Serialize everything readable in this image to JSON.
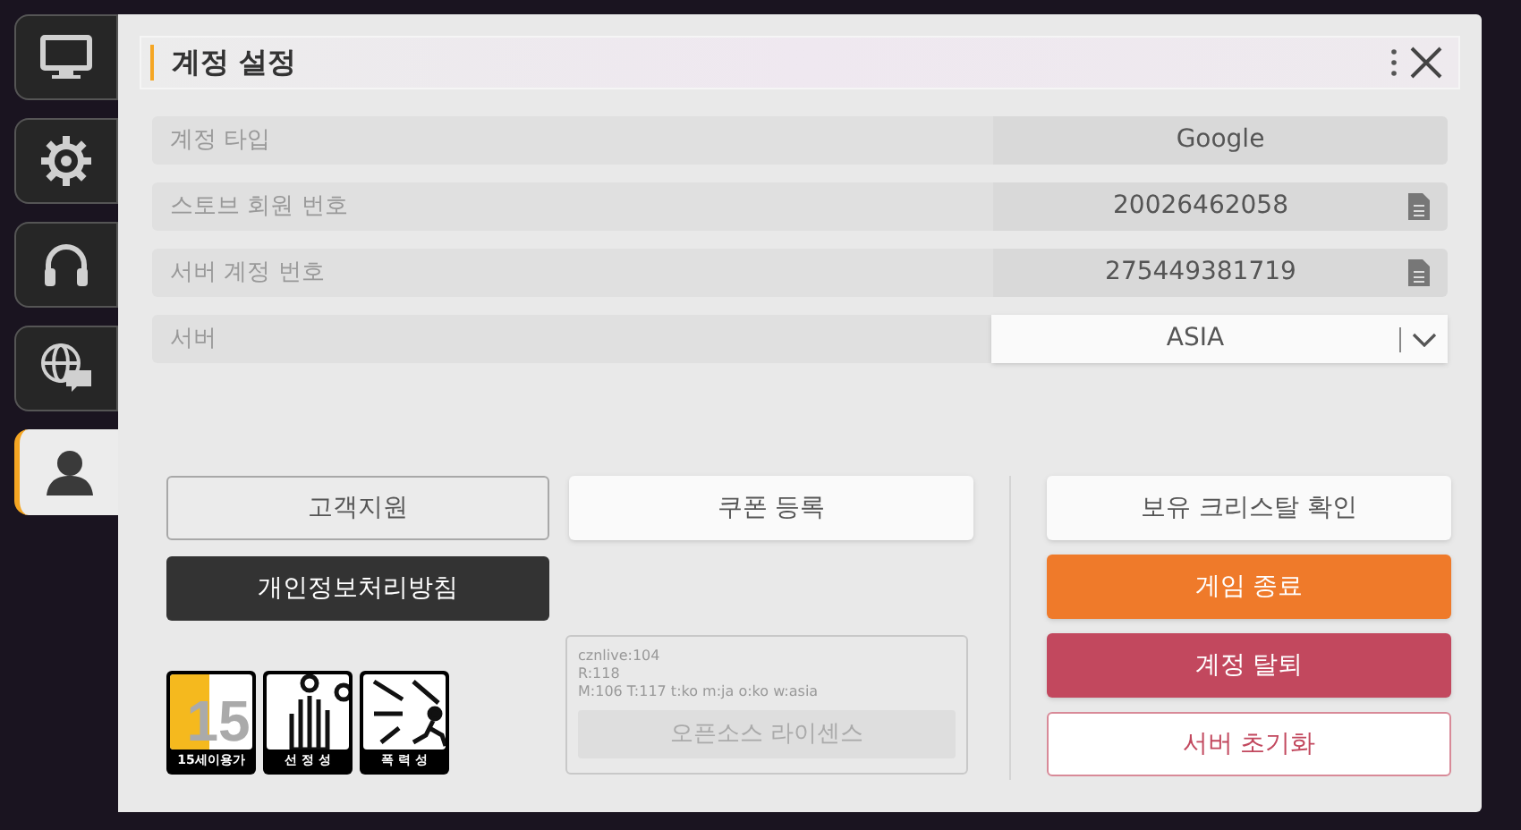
{
  "sidebar": {
    "tabs": [
      {
        "kind": "monitor",
        "selected": false
      },
      {
        "kind": "gear",
        "selected": false
      },
      {
        "kind": "headphones",
        "selected": false
      },
      {
        "kind": "globe-chat",
        "selected": false
      },
      {
        "kind": "user",
        "selected": true
      }
    ]
  },
  "title": "계정 설정",
  "rows": [
    {
      "label": "계정 타입",
      "value": "Google",
      "kind": "text"
    },
    {
      "label": "스토브 회원 번호",
      "value": "20026462058",
      "kind": "copy"
    },
    {
      "label": "서버 계정 번호",
      "value": "275449381719",
      "kind": "copy"
    },
    {
      "label": "서버",
      "value": "ASIA",
      "kind": "dropdown"
    }
  ],
  "left_buttons": [
    {
      "label": "고객지원",
      "kind": "outline"
    },
    {
      "label": "개인정보처리방침",
      "kind": "dark"
    }
  ],
  "coupon_button": {
    "label": "쿠폰 등록",
    "kind": "white"
  },
  "ratings": [
    {
      "kind": "age",
      "number": "15",
      "label": "15세이용가"
    },
    {
      "kind": "sexual",
      "label": "선 정 성"
    },
    {
      "kind": "violence",
      "label": "폭 력 성"
    }
  ],
  "info": {
    "lines": [
      "cznlive:104",
      "R:118",
      "M:106 T:117 t:ko m:ja o:ko w:asia"
    ],
    "license_button": "오픈소스 라이센스"
  },
  "right_buttons": [
    {
      "label": "보유 크리스탈 확인",
      "kind": "white"
    },
    {
      "label": "게임 종료",
      "kind": "orange"
    },
    {
      "label": "계정 탈퇴",
      "kind": "danger"
    },
    {
      "label": "서버 초기화",
      "kind": "danger-outline"
    }
  ]
}
